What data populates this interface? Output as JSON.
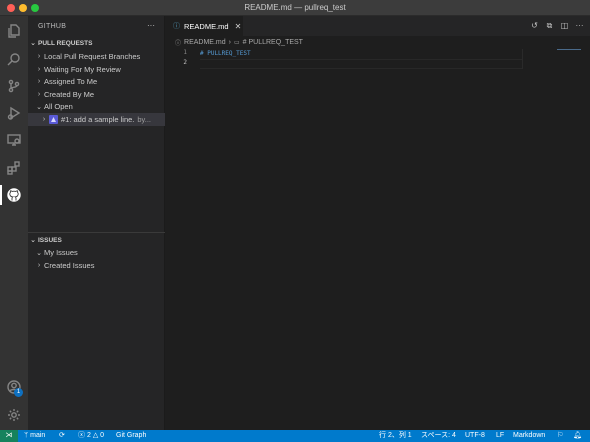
{
  "window": {
    "title": "README.md — pullreq_test"
  },
  "activity_bar": {
    "items": [
      {
        "name": "explorer-icon"
      },
      {
        "name": "search-icon"
      },
      {
        "name": "source-control-icon"
      },
      {
        "name": "run-debug-icon"
      },
      {
        "name": "remote-explorer-icon"
      },
      {
        "name": "extensions-icon"
      },
      {
        "name": "github-icon",
        "active": true
      }
    ],
    "accounts_badge": "1"
  },
  "sidebar": {
    "header": "GITHUB",
    "more": "···",
    "pull_requests": {
      "title": "PULL REQUESTS",
      "items": [
        {
          "label": "Local Pull Request Branches"
        },
        {
          "label": "Waiting For My Review"
        },
        {
          "label": "Assigned To Me"
        },
        {
          "label": "Created By Me"
        },
        {
          "label": "All Open"
        }
      ],
      "pr_item": {
        "label": "#1: add a sample line.",
        "suffix": "by..."
      }
    },
    "issues": {
      "title": "ISSUES",
      "items": [
        {
          "label": "My Issues"
        },
        {
          "label": "Created Issues"
        }
      ]
    }
  },
  "editor": {
    "tab": {
      "label": "README.md",
      "close": "✕"
    },
    "breadcrumb": {
      "file": "README.md",
      "symbol": "# PULLREQ_TEST"
    },
    "lines": [
      {
        "number": "1",
        "text": "# PULLREQ_TEST"
      },
      {
        "number": "2",
        "text": ""
      }
    ]
  },
  "statusbar": {
    "branch": "main",
    "errors": "2",
    "warnings": "0",
    "git_graph": "Git Graph",
    "position": "行 2、列 1",
    "spaces": "スペース: 4",
    "encoding": "UTF-8",
    "eol": "LF",
    "language": "Markdown"
  },
  "colors": {
    "accent": "#007acc",
    "remote": "#16825d",
    "heading": "#569cd6"
  }
}
